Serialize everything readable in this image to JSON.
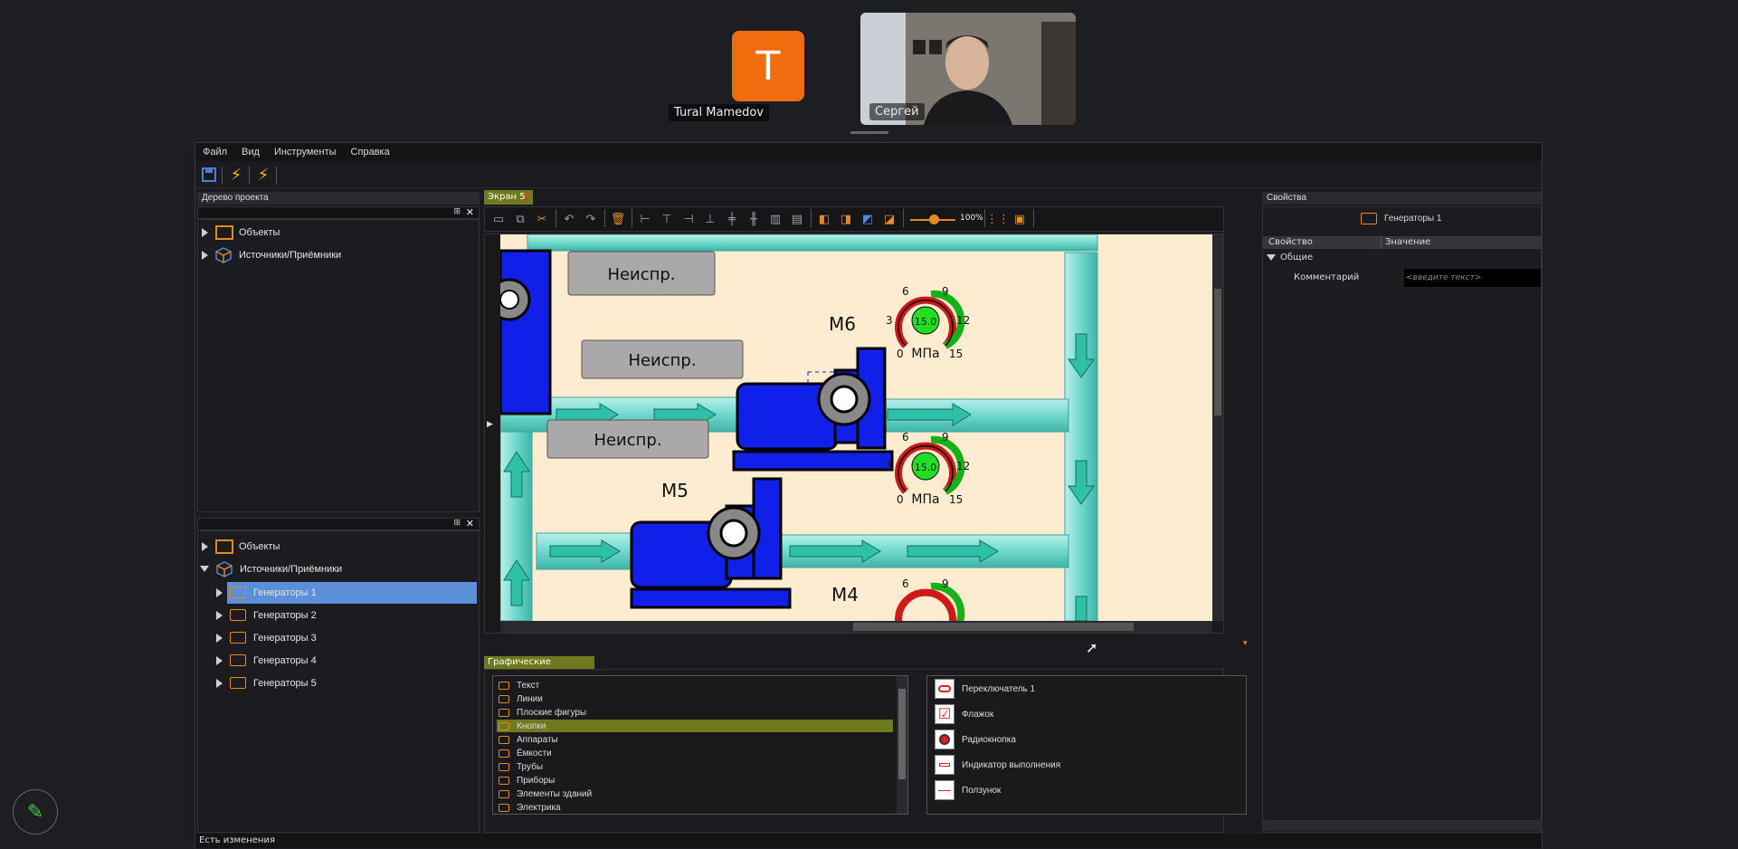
{
  "call": {
    "participant1": {
      "initial": "T",
      "name": "Tural Mamedov"
    },
    "participant2": {
      "name": "Сергей"
    }
  },
  "menu": [
    "Файл",
    "Вид",
    "Инструменты",
    "Справка"
  ],
  "project_tree": {
    "title": "Дерево проекта",
    "top_items": [
      "Объекты",
      "Источники/Приёмники"
    ],
    "bottom_items": [
      "Объекты",
      "Источники/Приёмники"
    ],
    "generators": [
      "Генераторы 1",
      "Генераторы 2",
      "Генераторы 3",
      "Генераторы 4",
      "Генераторы 5"
    ]
  },
  "editor": {
    "tab_label": "Экран 5",
    "zoom": "100%",
    "labels": {
      "m6": "M6",
      "m5": "M5",
      "m4": "M4"
    },
    "fault_text": "Неиспр.",
    "gauge": {
      "value": "15.0",
      "unit": "МПа",
      "ticks": [
        "0",
        "3",
        "6",
        "9",
        "12",
        "15"
      ]
    }
  },
  "properties": {
    "title": "Свойства",
    "object": "Генераторы 1",
    "col_property": "Свойство",
    "col_value": "Значение",
    "group": "Общие",
    "field_label": "Комментарий",
    "field_placeholder": "<введите текст>"
  },
  "library": {
    "tab": "Графические элементы",
    "categories": [
      "Текст",
      "Линии",
      "Плоские фигуры",
      "Кнопки",
      "Аппараты",
      "Ёмкости",
      "Трубы",
      "Приборы",
      "Элементы зданий",
      "Электрика"
    ],
    "selected": "Кнопки",
    "gallery": [
      "Переключатель 1",
      "Флажок",
      "Радиокнопка",
      "Индикатор выполнения",
      "Ползунок"
    ]
  },
  "status": "Есть изменения",
  "colors": {
    "accent": "#e58a1c",
    "selection": "#5b8fd8",
    "pipe": "#7fe0d6",
    "pump": "#1020e8",
    "canvas": "#fdecd0"
  }
}
